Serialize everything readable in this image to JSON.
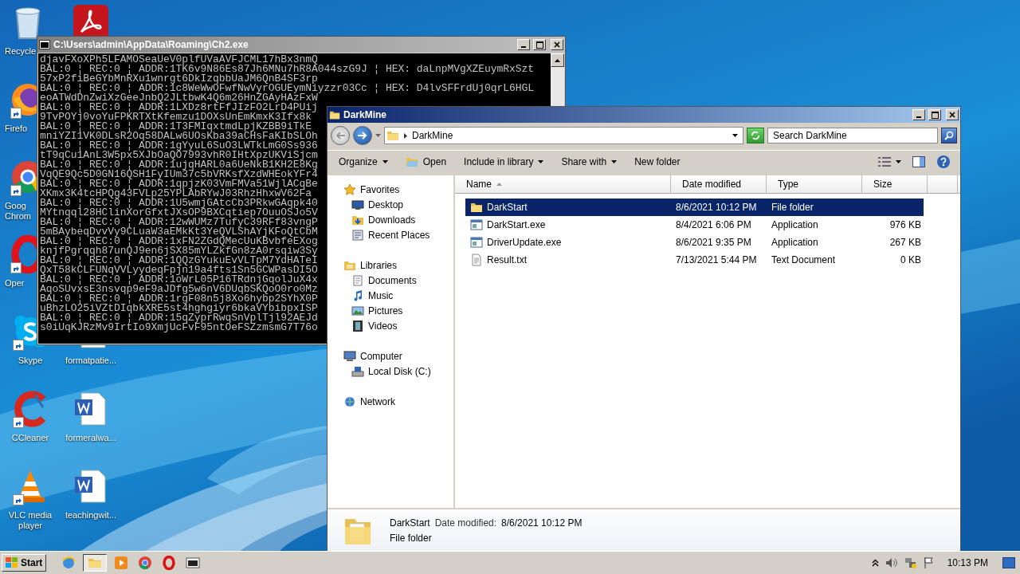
{
  "desktop": {
    "columns": [
      [
        {
          "label": [
            "Recycle"
          ],
          "kind": "recycle",
          "shortcut": false,
          "cut_off": true
        },
        {
          "label": [
            "Firefo"
          ],
          "kind": "firefox",
          "shortcut": true,
          "cut_off": true
        },
        {
          "label": [
            "Goog",
            "Chrom"
          ],
          "kind": "chrome",
          "shortcut": true,
          "cut_off": true
        },
        {
          "label": [
            "Oper"
          ],
          "kind": "opera",
          "shortcut": true,
          "cut_off": true
        },
        {
          "label": [
            "Skype"
          ],
          "kind": "skype",
          "shortcut": true,
          "cut_off": false
        },
        {
          "label": [
            "CCleaner"
          ],
          "kind": "ccleaner",
          "shortcut": true,
          "cut_off": false
        },
        {
          "label": [
            "VLC media",
            "player"
          ],
          "kind": "vlc",
          "shortcut": true,
          "cut_off": false
        }
      ],
      [
        {
          "kind": "acrobat",
          "shortcut": false,
          "cut_off": false
        },
        {
          "label": [
            "formatpatie..."
          ],
          "kind": "blank",
          "shortcut": false,
          "cut_off": false
        },
        {
          "label": [
            "formeralwa..."
          ],
          "kind": "word",
          "shortcut": false,
          "cut_off": false
        },
        {
          "label": [
            "teachingwit..."
          ],
          "kind": "word",
          "shortcut": false,
          "cut_off": false
        }
      ]
    ]
  },
  "console": {
    "title": "C:\\Users\\admin\\AppData\\Roaming\\Ch2.exe",
    "lines": [
      "djavFXoXPh5LFAMOSeaUeV0plfUVaAVFJCML17hBx3nmQ",
      "BAL:0 ¦ REC:0 ¦ ADDR:1TK6v9N86Es87Jh6MNu7hR8A044szG9J ¦ HEX: daLnpMVgXZEuymRxSzt",
      "57xP2fiBeGYbMnRXu1wnrgt6DkIzqbbUaJM6QnB4SF3rp",
      "BAL:0 ¦ REC:0 ¦ ADDR:1c8WeWwOFwfNwVyrOGUEymNiyzzr03Cc ¦ HEX: D4lvSFFrdUj0qrL6HGL",
      "eoATWdDnZwiXzGeeJnbQ2JLtbwK4Q6m26HnZGAyHAzFxW",
      "BAL:0 ¦ REC:0 ¦ ADDR:1LXDz8rtFfJIzFO2LrD4PUij",
      "9TvPOYj0voYuFPKRTXtKfemzu1DOXsUnEmKmxK3Ifx8k",
      "BAL:0 ¦ REC:0 ¦ ADDR:1T3FMIqxtmdLpjKZBB9iTkE",
      "mniYZI1VK0DLsR2Oq58DALw6UOsKba39aCHsFaKIbSLOh",
      "BAL:0 ¦ REC:0 ¦ ADDR:1gYyuL6SuO3LWTkLmG0Ss936",
      "tT9qCu1AnL3W5px5XJbOaQO7993vhR0IHtXpzUKViSjcm",
      "BAL:0 ¦ REC:0 ¦ ADDR:1ujqHARL0a6UeNkB1KH2E8Kg",
      "VqQE9Qc5D0GN16QSH1FyIUm37c5bVRKsfXzdWHEokYFr4",
      "BAL:0 ¦ REC:0 ¦ ADDR:1qpjzK03VmFMVa51WjlACqBe",
      "XKmx3K4tcHPQg43FVLp25YPLAbRYwJ03RhzHhxwV62Fa",
      "BAL:0 ¦ REC:0 ¦ ADDR:1U5wmjGAtcCb3PRkwGAqpk40",
      "MYtnqql28HClinXorGfxtJXsOP9BXCqtiep7OuuOSJo5V",
      "BAL:0 ¦ REC:0 ¦ ADDR:12wWUMz7TufyC39RFf83vngP",
      "5mBAybeqDvvVy9CLuaW3aEMkKt3YeQVLShAYjKFoQtCbM",
      "BAL:0 ¦ REC:0 ¦ ADDR:1xFN2ZGdQMecUuKBvbfeEXog",
      "knjfPgrqqh87unQJ9en6jSX85mYLZkfGn8zA0rsqiw3Sy",
      "BAL:0 ¦ REC:0 ¦ ADDR:1QQzGYukuEvVLTpM7YdHATeI",
      "QxT58kCLFUNqVVLyydeqFpjn19a4fts1Sn5GCWPasDI5O",
      "BAL:0 ¦ REC:0 ¦ ADDR:1oWrL05P16TRdnjGqolJuX4x",
      "AqoSUvxsE3nsvqp9eF9aJDfg5w6nV6DUqbSKQoO0ro0Mz",
      "BAL:0 ¦ REC:0 ¦ ADDR:1rgF08n5j8Xo6hybp2SYhX0P",
      "uBhzLO25iVZtDIqbkXRE5st4hghgiyr6bkaVYbibpxISP",
      "BAL:0 ¦ REC:0 ¦ ADDR:15qZyprRwqSnVplTjl92AEJd",
      "s0iUqKJRzMv9IrtIo9XmjUcFvF95ntOeFSZzmsmG7T76o"
    ]
  },
  "explorer": {
    "title": "DarkMine",
    "address": "DarkMine",
    "search": {
      "placeholder": "Search DarkMine"
    },
    "toolbar": [
      {
        "label": "Organize",
        "kind": "menu"
      },
      {
        "label": "Open",
        "kind": "open"
      },
      {
        "label": "Include in library",
        "kind": "menu"
      },
      {
        "label": "Share with",
        "kind": "menu"
      },
      {
        "label": "New folder",
        "kind": "plain"
      }
    ],
    "nav": [
      {
        "label": "Favorites",
        "kind": "star",
        "children": [
          {
            "label": "Desktop",
            "kind": "desktop"
          },
          {
            "label": "Downloads",
            "kind": "downloads"
          },
          {
            "label": "Recent Places",
            "kind": "recent"
          }
        ]
      },
      {
        "label": "Libraries",
        "kind": "library",
        "children": [
          {
            "label": "Documents",
            "kind": "documents"
          },
          {
            "label": "Music",
            "kind": "music"
          },
          {
            "label": "Pictures",
            "kind": "pictures"
          },
          {
            "label": "Videos",
            "kind": "videos"
          }
        ]
      },
      {
        "label": "Computer",
        "kind": "computer",
        "children": [
          {
            "label": "Local Disk (C:)",
            "kind": "disk"
          }
        ]
      },
      {
        "label": "Network",
        "kind": "network"
      }
    ],
    "files": {
      "columns": [
        "Name",
        "Date modified",
        "Type",
        "Size"
      ],
      "rows": [
        {
          "name": "DarkStart",
          "date": "8/6/2021 10:12 PM",
          "type": "File folder",
          "size": "",
          "kind": "folder",
          "selected": true
        },
        {
          "name": "DarkStart.exe",
          "date": "8/4/2021 6:06 PM",
          "type": "Application",
          "size": "976 KB",
          "kind": "app",
          "selected": false
        },
        {
          "name": "DriverUpdate.exe",
          "date": "8/6/2021 9:35 PM",
          "type": "Application",
          "size": "267 KB",
          "kind": "app",
          "selected": false
        },
        {
          "name": "Result.txt",
          "date": "7/13/2021 5:44 PM",
          "type": "Text Document",
          "size": "0 KB",
          "kind": "text",
          "selected": false
        }
      ]
    },
    "details": {
      "name": "DarkStart",
      "label": "Date modified:",
      "value": "8/6/2021 10:12 PM",
      "type": "File folder"
    }
  },
  "taskbar": {
    "start": "Start",
    "apps": [
      {
        "kind": "ie",
        "active": false
      },
      {
        "kind": "explorer",
        "active": true
      },
      {
        "kind": "media",
        "active": false
      },
      {
        "kind": "chrome",
        "active": false
      },
      {
        "kind": "opera",
        "active": false
      },
      {
        "kind": "console",
        "active": false
      }
    ],
    "clock": "10:13 PM"
  }
}
